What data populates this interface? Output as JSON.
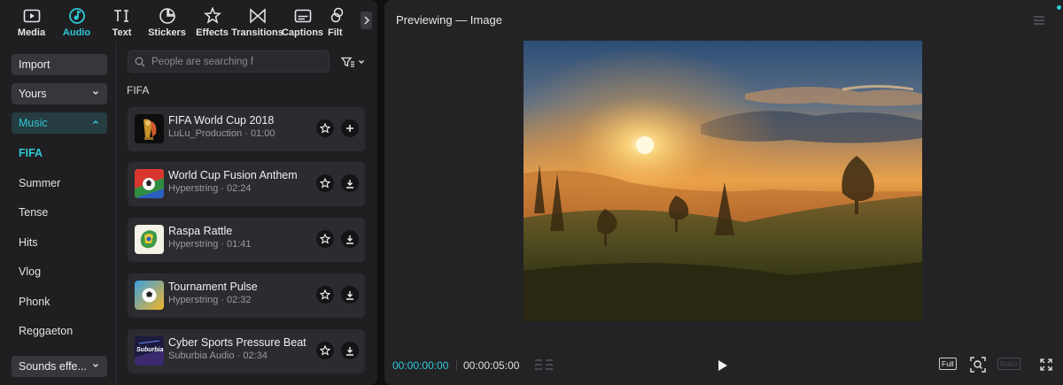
{
  "tabs": [
    {
      "label": "Media",
      "icon": "media-icon"
    },
    {
      "label": "Audio",
      "icon": "audio-icon",
      "active": true
    },
    {
      "label": "Text",
      "icon": "text-icon"
    },
    {
      "label": "Stickers",
      "icon": "stickers-icon"
    },
    {
      "label": "Effects",
      "icon": "effects-icon"
    },
    {
      "label": "Transitions",
      "icon": "transitions-icon"
    },
    {
      "label": "Captions",
      "icon": "captions-icon"
    },
    {
      "label": "Filt",
      "icon": "filters-icon"
    }
  ],
  "sidebar": {
    "import": "Import",
    "yours": "Yours",
    "music": "Music",
    "items": [
      "FIFA",
      "Summer",
      "Tense",
      "Hits",
      "Vlog",
      "Phonk",
      "Reggaeton"
    ],
    "active_item": "FIFA",
    "sounds": "Sounds effe..."
  },
  "search": {
    "placeholder": "People are searching f"
  },
  "section_title": "FIFA",
  "tracks": [
    {
      "title": "FIFA World Cup 2018",
      "subtitle": "LuLu_Production · 01:00",
      "action": "add-icon"
    },
    {
      "title": "World Cup Fusion Anthem",
      "subtitle": "Hyperstring · 02:24",
      "action": "download-icon"
    },
    {
      "title": "Raspa Rattle",
      "subtitle": "Hyperstring · 01:41",
      "action": "download-icon"
    },
    {
      "title": "Tournament Pulse",
      "subtitle": "Hyperstring · 02:32",
      "action": "download-icon"
    },
    {
      "title": "Cyber Sports Pressure Beat",
      "subtitle": "Suburbia Audio · 02:34",
      "action": "download-icon",
      "thumb_text": "Suburbia"
    }
  ],
  "preview": {
    "title": "Previewing — Image",
    "current_time": "00:00:00:00",
    "duration": "00:00:05:00",
    "full_label": "Full",
    "ratio_label": "Ratio"
  },
  "colors": {
    "accent": "#2fc9d6",
    "panel": "#1f1f22",
    "card": "#2c2c30"
  }
}
